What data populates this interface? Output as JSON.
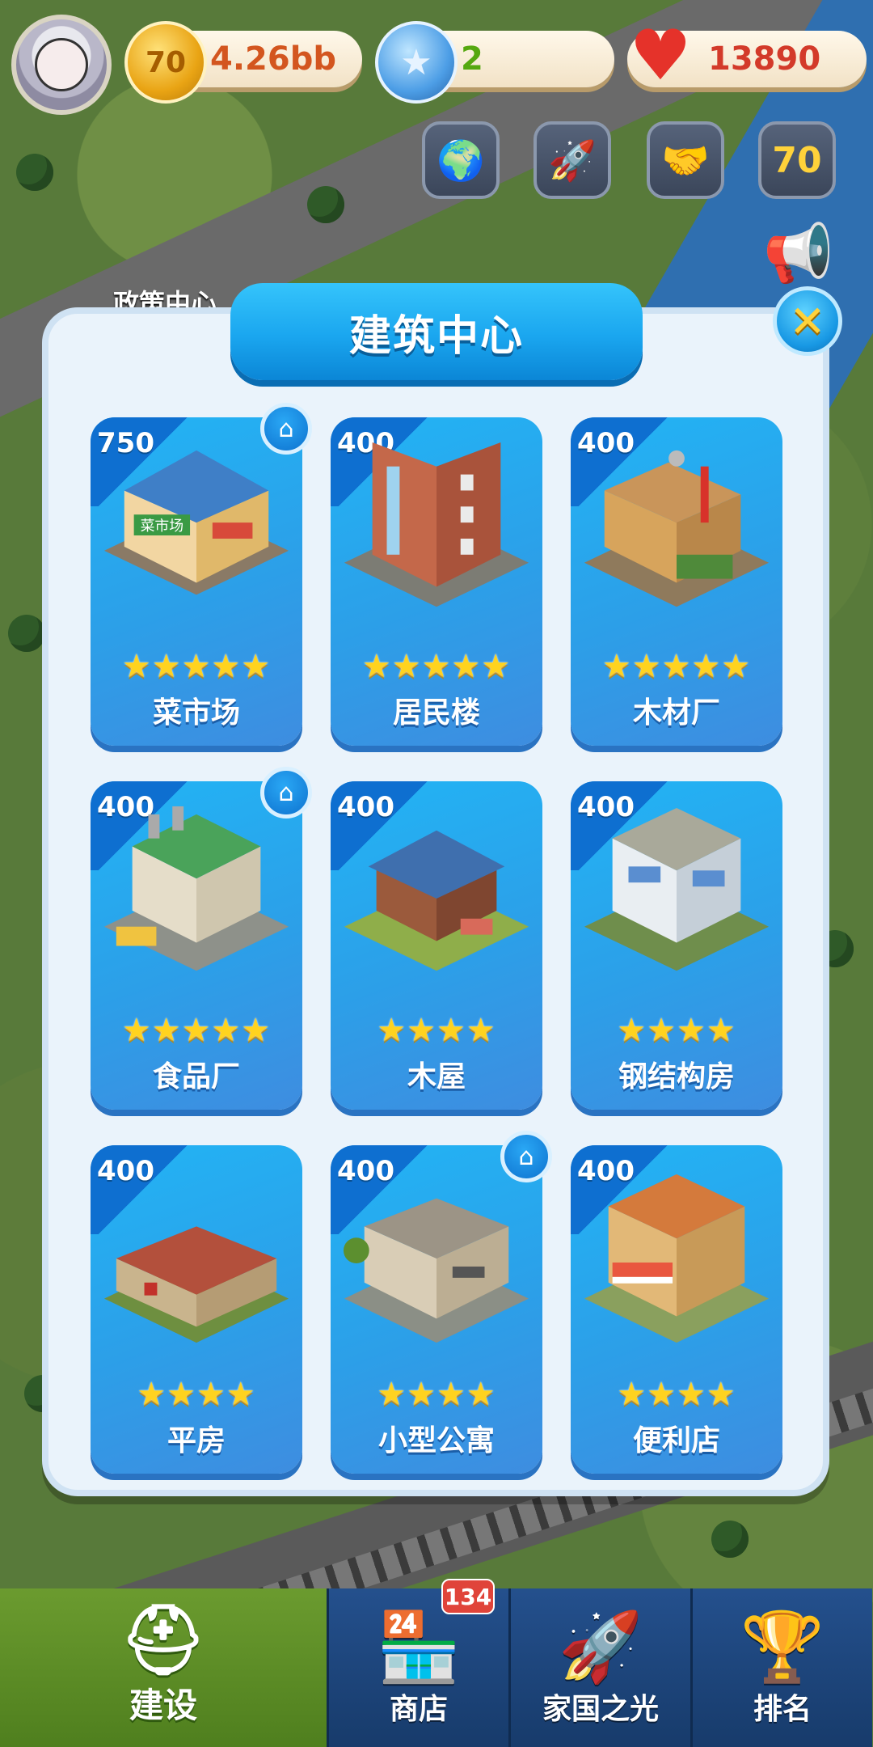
{
  "hud": {
    "coins": "4.26bb",
    "coin_icon_label": "70",
    "stars": "2",
    "hearts": "13890"
  },
  "quick_buttons": [
    "globe-icon",
    "rocket-icon",
    "handshake-icon",
    "anniversary-icon"
  ],
  "map_label": "政策中心",
  "dialog": {
    "title": "建筑中心",
    "close_label": "✕"
  },
  "buildings": [
    {
      "cost": "750",
      "stars": 5,
      "name": "菜市场",
      "has_home_badge": true
    },
    {
      "cost": "400",
      "stars": 5,
      "name": "居民楼",
      "has_home_badge": false
    },
    {
      "cost": "400",
      "stars": 5,
      "name": "木材厂",
      "has_home_badge": false
    },
    {
      "cost": "400",
      "stars": 5,
      "name": "食品厂",
      "has_home_badge": true
    },
    {
      "cost": "400",
      "stars": 4,
      "name": "木屋",
      "has_home_badge": false
    },
    {
      "cost": "400",
      "stars": 4,
      "name": "钢结构房",
      "has_home_badge": false
    },
    {
      "cost": "400",
      "stars": 4,
      "name": "平房",
      "has_home_badge": false
    },
    {
      "cost": "400",
      "stars": 4,
      "name": "小型公寓",
      "has_home_badge": true
    },
    {
      "cost": "400",
      "stars": 4,
      "name": "便利店",
      "has_home_badge": false
    }
  ],
  "bottom_nav": {
    "build": "建设",
    "shop": "商店",
    "shop_badge": "134",
    "homeland": "家国之光",
    "rank": "排名"
  },
  "colors": {
    "card_blue": "#2c9fe8",
    "star_gold": "#ffd31f",
    "nav_green": "#5b8b25",
    "nav_blue": "#1f467d"
  }
}
